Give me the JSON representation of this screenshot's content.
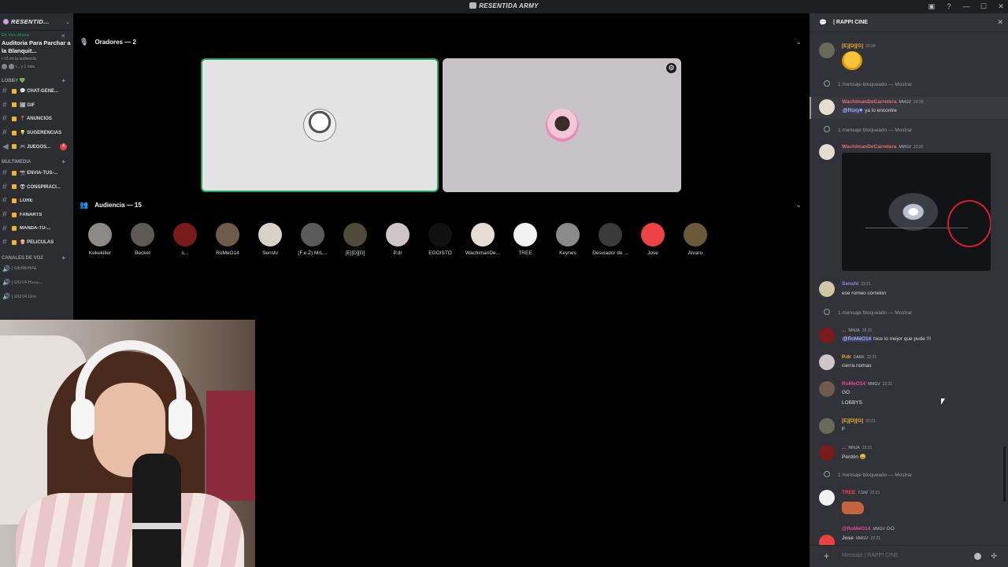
{
  "window": {
    "title": "RESENTIDA ARMY"
  },
  "sidebar": {
    "server_name": "RESENTID...",
    "live": {
      "label": "En Vivo Ahora",
      "title": "Auditoria Para Parchar a la Blanquit...",
      "sub": "• 15 en la audiencia",
      "avatars_text": "i... y 1 más"
    },
    "categories": [
      {
        "label": "LOBBY 💚",
        "channels": [
          {
            "label": "💬 CHAT-GENE...",
            "type": "text"
          },
          {
            "label": "🖼 GIF",
            "type": "text"
          },
          {
            "label": "📍 ANUNCIOS",
            "type": "text"
          },
          {
            "label": "💡 SUGERENCIAS",
            "type": "text"
          },
          {
            "label": "🎮 JUEGOS...",
            "type": "announce",
            "badge": "4"
          }
        ]
      },
      {
        "label": "MULTIMEDIA",
        "channels": [
          {
            "label": "📸 ENVIA-TUS-...",
            "type": "text"
          },
          {
            "label": "👽 CONSPIRACI...",
            "type": "text"
          },
          {
            "label": "LORE",
            "type": "text"
          },
          {
            "label": "FANARTS",
            "type": "text"
          },
          {
            "label": "MANDA-TU-...",
            "type": "text"
          },
          {
            "label": "🍿 PELICULAS",
            "type": "text"
          }
        ]
      },
      {
        "label": "CANALES DE VOZ",
        "channels": [
          {
            "label": "| GENERAL",
            "type": "voice"
          },
          {
            "label": "| DOTA Radia...",
            "type": "voice"
          },
          {
            "label": "| DOTA Dire",
            "type": "voice"
          }
        ]
      }
    ]
  },
  "stage": {
    "speakers_label": "Oradores — 2",
    "audience_label": "Audiencia — 15",
    "audience": [
      {
        "name": "Kekekiller",
        "color": "#8d8a86"
      },
      {
        "name": "Becket",
        "color": "#5d5a55"
      },
      {
        "name": "s...",
        "color": "#7a1a1a"
      },
      {
        "name": "RoMeO14",
        "color": "#6e5b4b"
      },
      {
        "name": "Senshi",
        "color": "#d9d2c8"
      },
      {
        "name": "(F.e.Z) MrL...",
        "color": "#5a5a5a"
      },
      {
        "name": "[E][D][G]",
        "color": "#4f4a3a"
      },
      {
        "name": "P.dr",
        "color": "#cfc4c8"
      },
      {
        "name": "EGOISTO",
        "color": "#111111"
      },
      {
        "name": "WachimanDe...",
        "color": "#e7dcd2"
      },
      {
        "name": "TREE",
        "color": "#f2f2f2"
      },
      {
        "name": "Keynes",
        "color": "#8a8a8a"
      },
      {
        "name": "Desviador de ...",
        "color": "#3a3a3a"
      },
      {
        "name": "Jose",
        "color": "#ed4245"
      },
      {
        "name": "Alvaro",
        "color": "#6b5a3a"
      }
    ]
  },
  "chat": {
    "title": "| RAPPI CINE",
    "blocked_text": "1 mensaje bloqueado —",
    "show_label": "Mostrar",
    "messages": [
      {
        "user": "[E][D][G]",
        "color": "#f0b232",
        "tag": "",
        "time": "22:20",
        "text": ""
      },
      {
        "user": "WachimanDeCarretera",
        "color": "#e06c75",
        "tag": "MMGV",
        "time": "22:20",
        "mention": "@Roxy♥",
        "text": "ya lo encontre"
      },
      {
        "user": "WachimanDeCarretera",
        "color": "#e06c75",
        "tag": "MMGV",
        "time": "22:20",
        "text": ""
      },
      {
        "user": "Senshi",
        "color": "#9b84ec",
        "tag": "",
        "time": "22:21",
        "text": "ese romeo correlon"
      },
      {
        "user": "...",
        "color": "#f23f43",
        "tag": "NINJA",
        "time": "22:21",
        "mention": "@RoMeO14",
        "text": "hice lo mejor que pude !!!"
      },
      {
        "user": "P.dr",
        "color": "#f0b232",
        "tag": "DARK",
        "time": "22:21",
        "text": "cierra nomas"
      },
      {
        "user": "RoMeO14",
        "color": "#eb459e",
        "tag": "MMGV",
        "time": "22:21",
        "text": "GO",
        "text2": "LOBBYS"
      },
      {
        "user": "[E][D][G]",
        "color": "#f0b232",
        "tag": "",
        "time": "22:21",
        "text": "F"
      },
      {
        "user": "...",
        "color": "#f23f43",
        "tag": "NINJA",
        "time": "22:21",
        "text": "Perdón 😅"
      },
      {
        "user": "TREE",
        "color": "#f23f43",
        "tag": "T.GW",
        "time": "22:21",
        "text": ""
      },
      {
        "user": "@RoMeO14",
        "color": "#eb459e",
        "tag": "MMGV",
        "time": "",
        "text": "GO"
      },
      {
        "user": "Jose",
        "color": "#b5bac1",
        "tag": "MMGV",
        "time": "22:21",
        "text": ""
      }
    ],
    "composer_placeholder": "Mensaje  | RAPPI CINE"
  }
}
